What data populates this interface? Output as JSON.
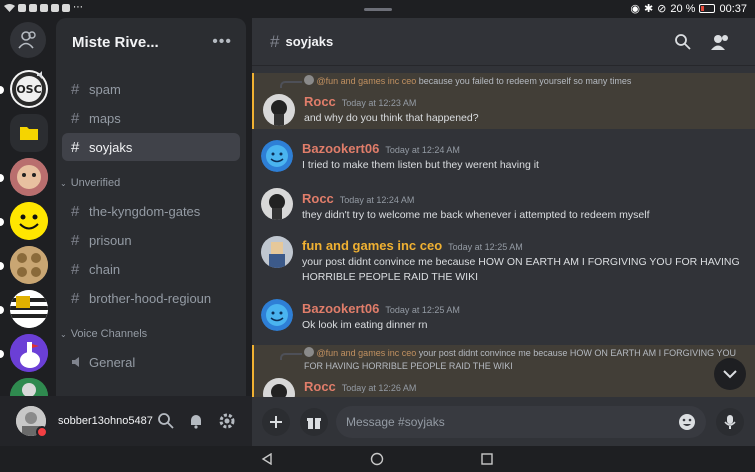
{
  "status_bar": {
    "battery": "20 %",
    "time": "00:37"
  },
  "server": {
    "name": "Miste Rive...",
    "more_label": "•••"
  },
  "channels": [
    {
      "name": "spam",
      "active": false
    },
    {
      "name": "maps",
      "active": false
    },
    {
      "name": "soyjaks",
      "active": true
    }
  ],
  "categories": [
    {
      "label": "Unverified",
      "channels": [
        "the-kyngdom-gates",
        "prisoun",
        "chain",
        "brother-hood-regioun"
      ]
    },
    {
      "label": "Voice Channels",
      "channels": [
        "General"
      ]
    }
  ],
  "user": {
    "name": "sobber13ohno5487"
  },
  "chat": {
    "channel": "soyjaks",
    "composer_placeholder": "Message #soyjaks",
    "messages": [
      {
        "reply_to": "@fun and games inc ceo",
        "reply_text": "because you failed to redeem yourself so many times",
        "author": "Rocc",
        "author_color": "#e07d6a",
        "time": "Today at 12:23 AM",
        "text": "and why do you think that happened?"
      },
      {
        "author": "Bazookert06",
        "author_color": "#e07d6a",
        "time": "Today at 12:24 AM",
        "text": "I tried to make them listen but they werent having it"
      },
      {
        "author": "Rocc",
        "author_color": "#e07d6a",
        "time": "Today at 12:24 AM",
        "text": "they didn't try to welcome me back whenever i attempted to redeem myself"
      },
      {
        "author": "fun and games inc ceo",
        "author_color": "#f0b132",
        "time": "Today at 12:25 AM",
        "text": "your post didnt convince me because HOW ON EARTH AM I FORGIVING YOU FOR HAVING HORRIBLE PEOPLE RAID THE WIKI"
      },
      {
        "author": "Bazookert06",
        "author_color": "#e07d6a",
        "time": "Today at 12:25 AM",
        "text": "Ok look im eating dinner rn"
      },
      {
        "reply_to": "@fun and games inc ceo",
        "reply_text": "your post didnt convince me because HOW ON EARTH AM I FORGIVING YOU FOR HAVING HORRIBLE PEOPLE RAID THE WIKI",
        "author": "Rocc",
        "author_color": "#e07d6a",
        "time": "Today at 12:26 AM",
        "text": ""
      }
    ]
  },
  "colors": {
    "accent_mention": "#f0b132",
    "dnd": "#f23f43"
  }
}
